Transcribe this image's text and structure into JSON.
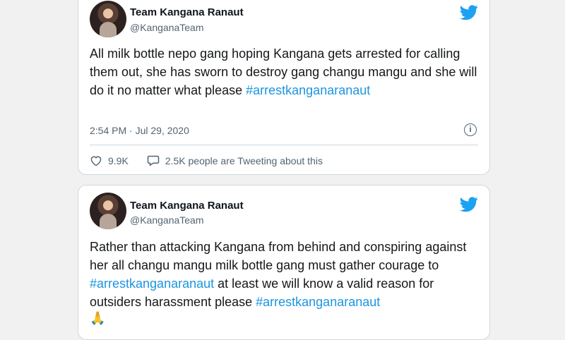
{
  "colors": {
    "twitter_blue": "#1da1f2",
    "link": "#1b95e0",
    "text": "#14171a",
    "muted": "#536471"
  },
  "tweets": [
    {
      "author": "Team Kangana Ranaut",
      "handle": "@KanganaTeam",
      "text_plain": "All milk bottle nepo gang hoping Kangana gets arrested for calling them out, she has sworn to destroy gang changu mangu and she will do it no matter what  please ",
      "hashtag1": "#arrestkanganaranaut",
      "timestamp": "2:54 PM · Jul 29, 2020",
      "likes": "9.9K",
      "replies_text": "2.5K people are Tweeting about this"
    },
    {
      "author": "Team Kangana Ranaut",
      "handle": "@KanganaTeam",
      "text_part1": "Rather than attacking Kangana from behind and conspiring against her all changu mangu milk bottle gang must gather courage to ",
      "hashtag1": "#arrestkanganaranaut",
      "text_part2": " at least we will know a valid reason for outsiders harassment please ",
      "hashtag2": "#arrestkanganaranaut",
      "emoji": "🙏"
    }
  ]
}
